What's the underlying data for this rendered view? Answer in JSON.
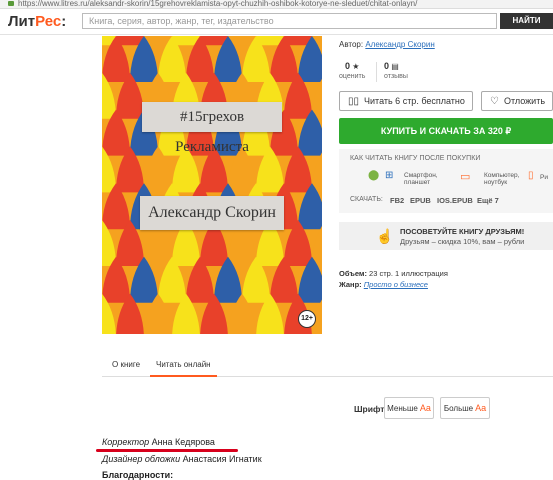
{
  "browser": {
    "url": "https://www.litres.ru/aleksandr-skorin/15grehovreklamista-opyt-chuzhih-oshibok-kotorye-ne-sleduet/chitat-onlayn/"
  },
  "header": {
    "logo_main": "Лит",
    "logo_accent": "Рес",
    "logo_colon": ":",
    "search_placeholder": "Книга, серия, автор, жанр, тег, издательство",
    "search_button": "НАЙТИ"
  },
  "cover": {
    "title": "#15грехов Рекламиста",
    "author": "Александр Скорин",
    "age": "12+",
    "colors": {
      "red": "#e8412a",
      "orange": "#f5a21f",
      "yellow": "#f7e21b",
      "blue": "#2e5fa8",
      "bg": "#f2b25a"
    }
  },
  "book": {
    "author_label": "Автор:",
    "author_name": "Александр Скорин",
    "rating_value": "0",
    "rating_label": "оценить",
    "reviews_value": "0",
    "reviews_label": "отзывы",
    "read_button": "Читать 6 стр. бесплатно",
    "defer_button": "Отложить",
    "buy_button": "КУПИТЬ И СКАЧАТЬ ЗА 320 ₽",
    "how_to_read_title": "КАК ЧИТАТЬ КНИГУ ПОСЛЕ ПОКУПКИ",
    "devices": {
      "smartphone": "Смартфон,",
      "smartphone2": "планшет",
      "computer": "Компьютер,",
      "computer2": "ноутбук",
      "reader": "Ри"
    },
    "download_label": "СКАЧАТЬ:",
    "formats": [
      "FB2",
      "EPUB",
      "IOS.EPUB",
      "Ещё 7"
    ],
    "recommend_title": "ПОСОВЕТУЙТЕ КНИГУ ДРУЗЬЯМ!",
    "recommend_sub": "Друзьям – скидка 10%, вам – рубли",
    "volume_label": "Объем:",
    "volume_value": "23 стр. 1 иллюстрация",
    "genre_label": "Жанр:",
    "genre_value": "Просто о бизнесе"
  },
  "tabs": [
    {
      "label": "О книге",
      "active": false
    },
    {
      "label": "Читать онлайн",
      "active": true
    }
  ],
  "reader": {
    "font_label": "Шрифт:",
    "smaller": "Меньше",
    "bigger": "Больше",
    "aa": "Aa"
  },
  "content": {
    "corrector_role": "Корректор",
    "corrector_name": " Анна Кедярова",
    "designer_role": "Дизайнер обложки",
    "designer_name": " Анастасия Игнатик",
    "thanks": "Благодарности:"
  }
}
